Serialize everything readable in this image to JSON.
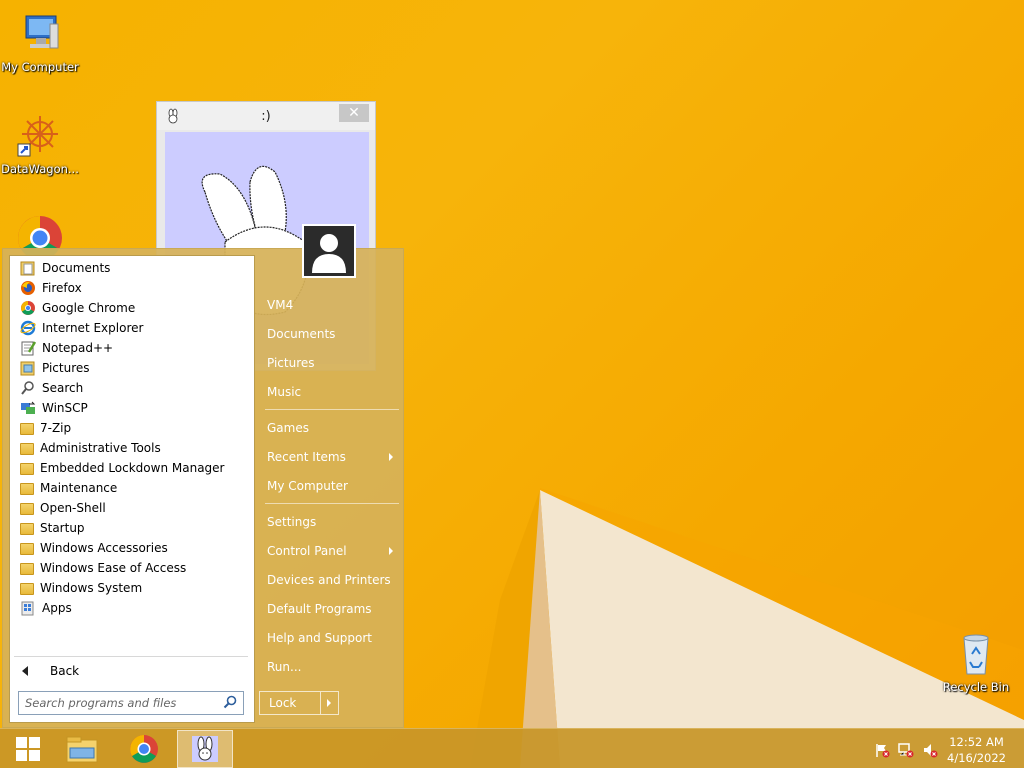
{
  "desktop": {
    "icons": [
      {
        "label": "My Computer",
        "icon": "computer-icon"
      },
      {
        "label": "DataWagon...",
        "icon": "datawagon-icon"
      },
      {
        "label": "",
        "icon": "chrome-icon"
      },
      {
        "label": "Recycle Bin",
        "icon": "recycle-bin-icon"
      }
    ]
  },
  "smile_window": {
    "title": ":)",
    "close_label": "✕"
  },
  "start_menu": {
    "programs": [
      {
        "label": "Documents",
        "icon": "documents-folder-icon"
      },
      {
        "label": "Firefox",
        "icon": "firefox-icon"
      },
      {
        "label": "Google Chrome",
        "icon": "chrome-icon"
      },
      {
        "label": "Internet Explorer",
        "icon": "internet-explorer-icon"
      },
      {
        "label": "Notepad++",
        "icon": "notepadpp-icon"
      },
      {
        "label": "Pictures",
        "icon": "pictures-folder-icon"
      },
      {
        "label": "Search",
        "icon": "search-icon"
      },
      {
        "label": "WinSCP",
        "icon": "winscp-icon"
      },
      {
        "label": "7-Zip",
        "icon": "folder-icon"
      },
      {
        "label": "Administrative Tools",
        "icon": "folder-icon"
      },
      {
        "label": "Embedded Lockdown Manager",
        "icon": "folder-icon"
      },
      {
        "label": "Maintenance",
        "icon": "folder-icon"
      },
      {
        "label": "Open-Shell",
        "icon": "folder-icon"
      },
      {
        "label": "Startup",
        "icon": "folder-icon"
      },
      {
        "label": "Windows Accessories",
        "icon": "folder-icon"
      },
      {
        "label": "Windows Ease of Access",
        "icon": "folder-icon"
      },
      {
        "label": "Windows System",
        "icon": "folder-icon"
      },
      {
        "label": "Apps",
        "icon": "apps-icon"
      }
    ],
    "back_label": "Back",
    "search_placeholder": "Search programs and files",
    "right_items": [
      {
        "label": "VM4",
        "submenu": false
      },
      {
        "label": "Documents",
        "submenu": false
      },
      {
        "label": "Pictures",
        "submenu": false
      },
      {
        "label": "Music",
        "submenu": false
      },
      {
        "label": "Games",
        "submenu": false
      },
      {
        "label": "Recent Items",
        "submenu": true
      },
      {
        "label": "My Computer",
        "submenu": false
      },
      {
        "label": "Settings",
        "submenu": false
      },
      {
        "label": "Control Panel",
        "submenu": true
      },
      {
        "label": "Devices and Printers",
        "submenu": false
      },
      {
        "label": "Default Programs",
        "submenu": false
      },
      {
        "label": "Help and Support",
        "submenu": false
      },
      {
        "label": "Run...",
        "submenu": false
      }
    ],
    "lock_label": "Lock"
  },
  "taskbar": {
    "pinned": [
      "start-button",
      "file-explorer-icon",
      "chrome-icon",
      "bunny-app-icon"
    ],
    "clock_time": "12:52 AM",
    "clock_date": "4/16/2022"
  },
  "colors": {
    "wallpaper": "#f6b200",
    "menu_bg": "#d6b258",
    "taskbar_bg": "#c89628"
  }
}
